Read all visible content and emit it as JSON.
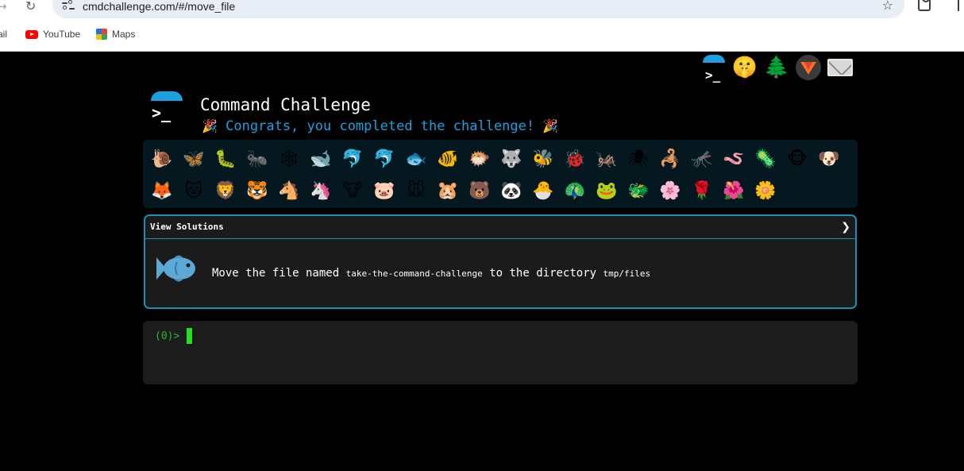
{
  "browser": {
    "url": "cmdchallenge.com/#/move_file",
    "bookmarks": [
      {
        "label": "ail",
        "icon": "gmail-icon"
      },
      {
        "label": "YouTube",
        "icon": "youtube-icon"
      },
      {
        "label": "Maps",
        "icon": "maps-icon"
      }
    ]
  },
  "top_icons": [
    "cmdchallenge-logo-icon",
    "shushing-face-icon",
    "christmas-tree-icon",
    "gitlab-icon",
    "envelope-icon"
  ],
  "header": {
    "title": "Command Challenge",
    "congrats": "Congrats, you completed the challenge!",
    "logo_prompt": ">_"
  },
  "animals": {
    "row1": [
      "🐌",
      "🦋",
      "🐛",
      "🐜",
      "🕸",
      "🐋",
      "🐬",
      "🐬",
      "🐟",
      "🐠",
      "🐡",
      "🐺",
      "🐝",
      "🐞",
      "🦗",
      "🕷",
      "🦂",
      "🦟",
      "🪱",
      "🦠",
      "🐵",
      "🐶"
    ],
    "row2": [
      "🦊",
      "🐱",
      "🦁",
      "🐯",
      "🐴",
      "🦄",
      "🐮",
      "🐷",
      "🐭",
      "🐹",
      "🐻",
      "🐼",
      "🐣",
      "🦚",
      "🐸",
      "🐲",
      "🌸",
      "🌹",
      "🌺",
      "🌼"
    ]
  },
  "solutions": {
    "title": "View Solutions",
    "chevron": "❯",
    "task_prefix": "Move the file named",
    "task_file": "take-the-command-challenge",
    "task_middle": "to the directory",
    "task_dir": "tmp/files"
  },
  "terminal": {
    "prompt": "(0)>"
  },
  "colors": {
    "accent": "#1ba0e1",
    "panel_border": "#1a8fb5",
    "prompt_green": "#2fb52f",
    "cursor_green": "#22e022"
  }
}
